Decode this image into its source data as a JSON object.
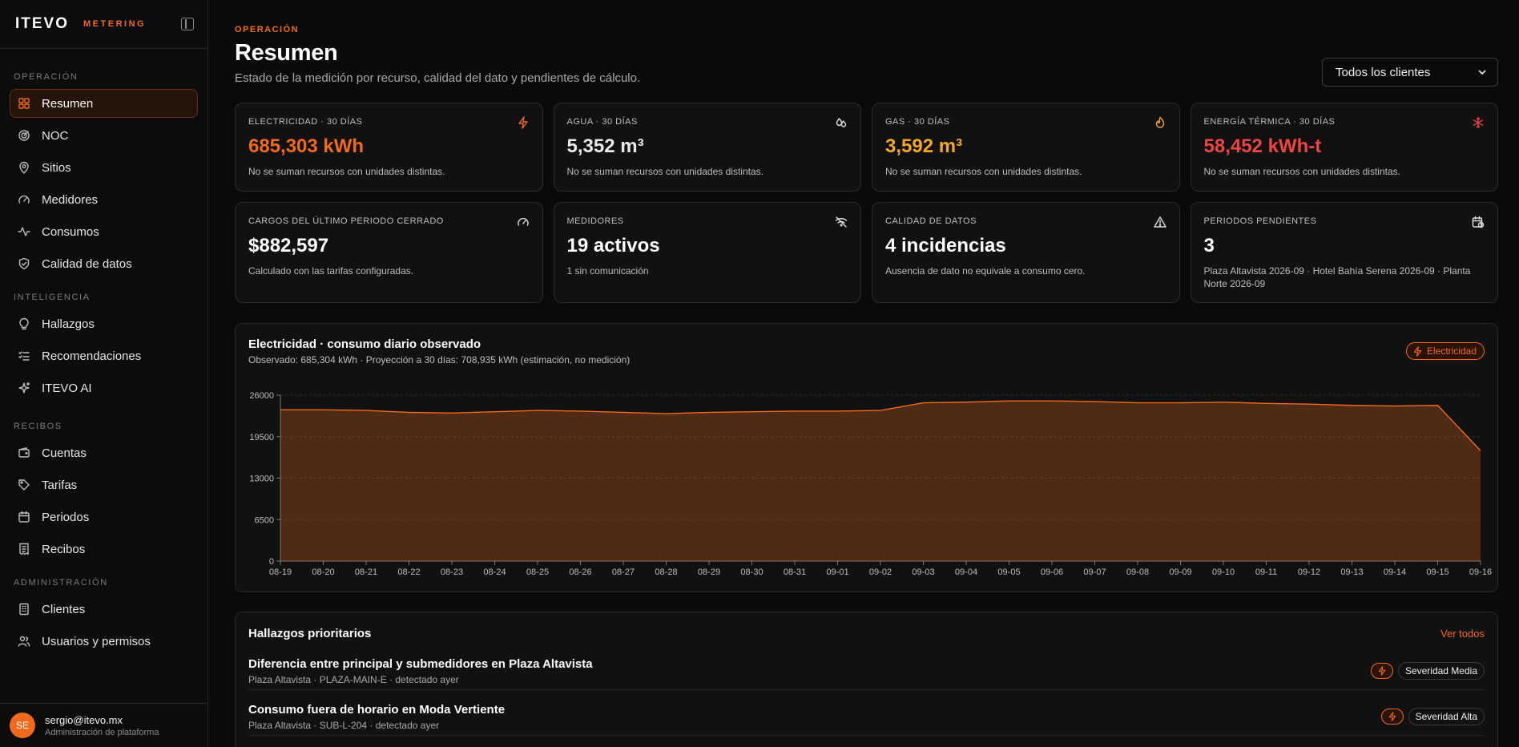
{
  "brand": {
    "logo": "ITEVO",
    "product": "METERING"
  },
  "sidebar": {
    "sections": [
      {
        "title": "OPERACIÓN",
        "items": [
          {
            "label": "Resumen",
            "icon": "dashboard-grid-icon",
            "active": true
          },
          {
            "label": "NOC",
            "icon": "radar-icon"
          },
          {
            "label": "Sitios",
            "icon": "map-pin-icon"
          },
          {
            "label": "Medidores",
            "icon": "gauge-icon"
          },
          {
            "label": "Consumos",
            "icon": "activity-icon"
          },
          {
            "label": "Calidad de datos",
            "icon": "shield-check-icon"
          }
        ]
      },
      {
        "title": "INTELIGENCIA",
        "items": [
          {
            "label": "Hallazgos",
            "icon": "lightbulb-icon"
          },
          {
            "label": "Recomendaciones",
            "icon": "checklist-icon"
          },
          {
            "label": "ITEVO AI",
            "icon": "sparkles-icon"
          }
        ]
      },
      {
        "title": "RECIBOS",
        "items": [
          {
            "label": "Cuentas",
            "icon": "wallet-icon"
          },
          {
            "label": "Tarifas",
            "icon": "tag-icon"
          },
          {
            "label": "Periodos",
            "icon": "calendar-icon"
          },
          {
            "label": "Recibos",
            "icon": "receipt-icon"
          }
        ]
      },
      {
        "title": "ADMINISTRACIÓN",
        "items": [
          {
            "label": "Clientes",
            "icon": "building-icon"
          },
          {
            "label": "Usuarios y permisos",
            "icon": "users-icon"
          }
        ]
      }
    ]
  },
  "user": {
    "initials": "SE",
    "email": "sergio@itevo.mx",
    "role": "Administración de plataforma"
  },
  "header": {
    "eyebrow": "OPERACIÓN",
    "title": "Resumen",
    "subtitle": "Estado de la medición por recurso, calidad del dato y pendientes de cálculo.",
    "client_select": "Todos los clientes"
  },
  "kpis": [
    {
      "label": "ELECTRICIDAD · 30 DÍAS",
      "value": "685,303 kWh",
      "note": "No se suman recursos con unidades distintas.",
      "color": "#f26a1b",
      "icon": "bolt-icon"
    },
    {
      "label": "AGUA · 30 DÍAS",
      "value": "5,352 m³",
      "note": "No se suman recursos con unidades distintas.",
      "color": "#e8e8e8",
      "icon": "droplets-icon"
    },
    {
      "label": "GAS · 30 DÍAS",
      "value": "3,592 m³",
      "note": "No se suman recursos con unidades distintas.",
      "color": "#f5a623",
      "icon": "flame-icon"
    },
    {
      "label": "ENERGÍA TÉRMICA · 30 DÍAS",
      "value": "58,452 kWh-t",
      "note": "No se suman recursos con unidades distintas.",
      "color": "#ef4444",
      "icon": "snowflake-icon"
    }
  ],
  "stats": [
    {
      "label": "CARGOS DEL ÚLTIMO PERIODO CERRADO",
      "value": "$882,597",
      "note": "Calculado con las tarifas configuradas.",
      "icon": "gauge-icon"
    },
    {
      "label": "MEDIDORES",
      "value": "19 activos",
      "note": "1 sin comunicación",
      "icon": "wifi-off-icon"
    },
    {
      "label": "CALIDAD DE DATOS",
      "value": "4 incidencias",
      "note": "Ausencia de dato no equivale a consumo cero.",
      "icon": "warning-triangle-icon"
    },
    {
      "label": "PERIODOS PENDIENTES",
      "value": "3",
      "note": "Plaza Altavista 2026-09 · Hotel Bahía Serena 2026-09 · Planta Norte 2026-09",
      "icon": "calendar-clock-icon"
    }
  ],
  "chart": {
    "title": "Electricidad · consumo diario observado",
    "subtitle": "Observado: 685,304 kWh · Proyección a 30 días: 708,935 kWh (estimación, no medición)",
    "badge": "Electricidad"
  },
  "chart_data": {
    "type": "area",
    "categories": [
      "08-19",
      "08-20",
      "08-21",
      "08-22",
      "08-23",
      "08-24",
      "08-25",
      "08-26",
      "08-27",
      "08-28",
      "08-29",
      "08-30",
      "08-31",
      "09-01",
      "09-02",
      "09-03",
      "09-04",
      "09-05",
      "09-06",
      "09-07",
      "09-08",
      "09-09",
      "09-10",
      "09-11",
      "09-12",
      "09-13",
      "09-14",
      "09-15",
      "09-16"
    ],
    "values": [
      23700,
      23700,
      23600,
      23300,
      23200,
      23400,
      23600,
      23500,
      23300,
      23100,
      23300,
      23400,
      23500,
      23500,
      23600,
      24800,
      24900,
      25100,
      25100,
      25000,
      24800,
      24800,
      24900,
      24700,
      24600,
      24400,
      24300,
      24400,
      17300
    ],
    "ylim": [
      0,
      26000
    ],
    "yticks": [
      "0",
      "6500",
      "13000",
      "19500",
      "26000"
    ],
    "grid": true,
    "color": "#f26a1b"
  },
  "findings": {
    "title": "Hallazgos prioritarios",
    "see_all": "Ver todos",
    "items": [
      {
        "title": "Diferencia entre principal y submedidores en Plaza Altavista",
        "meta": "Plaza Altavista · PLAZA-MAIN-E · detectado ayer",
        "severity": "Severidad Media",
        "icon": "bolt-icon"
      },
      {
        "title": "Consumo fuera de horario en Moda Vertiente",
        "meta": "Plaza Altavista · SUB-L-204 · detectado ayer",
        "severity": "Severidad Alta",
        "icon": "bolt-icon"
      }
    ]
  }
}
